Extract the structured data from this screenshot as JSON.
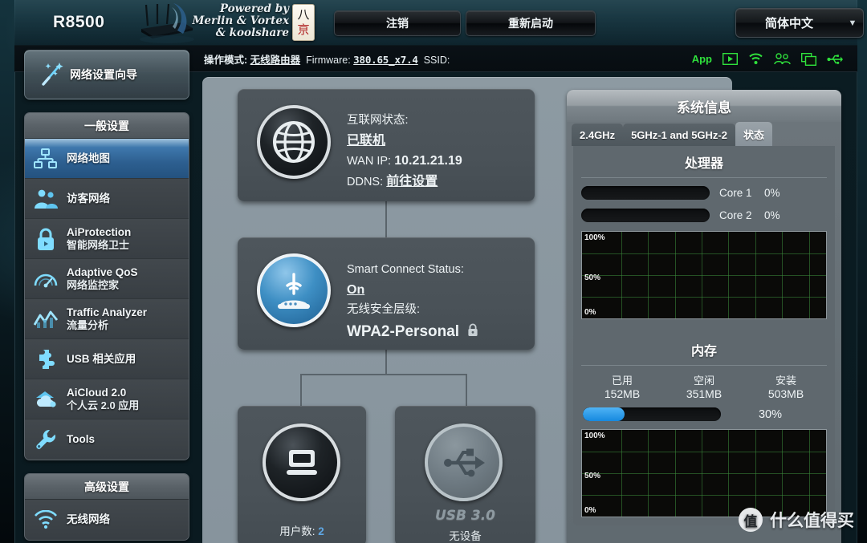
{
  "header": {
    "model": "R8500",
    "powered_by_line1": "Powered by",
    "powered_by_line2": "Merlin & Vortex",
    "powered_by_line3": "& koolshare",
    "tile_top": "八",
    "tile_bottom": "亰",
    "logout_label": "注销",
    "reboot_label": "重新启动",
    "language_label": "简体中文"
  },
  "infobar": {
    "mode_label": "操作模式:",
    "mode_value": "无线路由器",
    "firmware_label": "Firmware:",
    "firmware_value": "380.65_x7.4",
    "ssid_label": "SSID:",
    "ssid_value": "",
    "icons": [
      "App",
      "play-icon",
      "wifi-icon",
      "users-icon",
      "screens-icon",
      "usb-icon"
    ]
  },
  "sidebar": {
    "wizard_label": "网络设置向导",
    "groups": [
      {
        "title": "一般设置",
        "items": [
          {
            "l1": "网络地图",
            "l2": "",
            "icon": "network-map-icon",
            "active": true
          },
          {
            "l1": "访客网络",
            "l2": "",
            "icon": "guest-network-icon",
            "active": false
          },
          {
            "l1": "AiProtection",
            "l2": "智能网络卫士",
            "icon": "lock-icon",
            "active": false
          },
          {
            "l1": "Adaptive QoS",
            "l2": "网络监控家",
            "icon": "gauge-icon",
            "active": false
          },
          {
            "l1": "Traffic Analyzer",
            "l2": "流量分析",
            "icon": "chart-icon",
            "active": false
          },
          {
            "l1": "USB 相关应用",
            "l2": "",
            "icon": "puzzle-icon",
            "active": false
          },
          {
            "l1": "AiCloud 2.0",
            "l2": "个人云 2.0 应用",
            "icon": "cloud-icon",
            "active": false
          },
          {
            "l1": "Tools",
            "l2": "",
            "icon": "wrench-icon",
            "active": false
          }
        ]
      },
      {
        "title": "高级设置",
        "items": [
          {
            "l1": "无线网络",
            "l2": "",
            "icon": "wifi-icon",
            "active": false
          }
        ]
      }
    ]
  },
  "netmap": {
    "internet": {
      "status_label": "互联网状态:",
      "status_value": "已联机",
      "wan_ip_label": "WAN IP:",
      "wan_ip_value": "10.21.21.19",
      "ddns_label": "DDNS:",
      "ddns_value": "前往设置",
      "icon": "globe-icon"
    },
    "smart_connect": {
      "status_label": "Smart Connect Status:",
      "status_value": "On",
      "security_label": "无线安全层级:",
      "security_value": "WPA2-Personal",
      "icon": "router-icon",
      "lock_icon": "lock-icon"
    },
    "clients": {
      "caption_label": "用户数:",
      "caption_value": "2",
      "icon": "monitor-icon"
    },
    "usb": {
      "title": "USB 3.0",
      "subtitle": "无设备",
      "icon": "usb-icon"
    }
  },
  "sysinfo": {
    "title": "系统信息",
    "tabs": [
      {
        "label": "2.4GHz",
        "active": false
      },
      {
        "label": "5GHz-1 and 5GHz-2",
        "active": false
      },
      {
        "label": "状态",
        "active": true
      }
    ],
    "cpu": {
      "title": "处理器",
      "cores": [
        {
          "name": "Core 1",
          "percent": "0%",
          "value": 0
        },
        {
          "name": "Core 2",
          "percent": "0%",
          "value": 0
        }
      ],
      "graph_labels": {
        "top": "100%",
        "mid": "50%",
        "bottom": "0%"
      }
    },
    "memory": {
      "title": "内存",
      "used_label": "已用",
      "used_value": "152MB",
      "free_label": "空闲",
      "free_value": "351MB",
      "total_label": "安装",
      "total_value": "503MB",
      "percent": "30%",
      "graph_labels": {
        "top": "100%",
        "mid": "50%",
        "bottom": "0%"
      }
    }
  },
  "watermark": {
    "badge": "值",
    "text": "什么值得买"
  },
  "colors": {
    "accent_blue": "#1689df",
    "status_green": "#2fe03c",
    "active_item": "#2d5f90"
  }
}
